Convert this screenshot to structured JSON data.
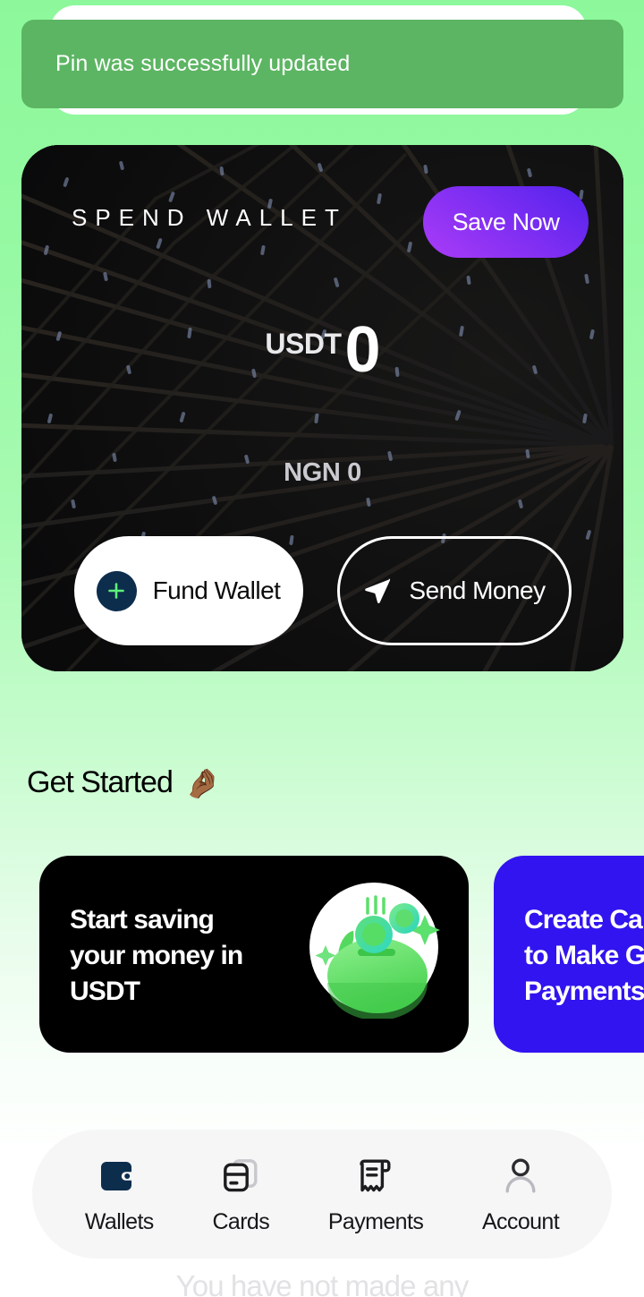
{
  "toast": {
    "message": "Pin was successfully updated",
    "bg_color": "#5CB562",
    "text_color": "#FFFFFF"
  },
  "wallet_card": {
    "label": "SPEND WALLET",
    "save_button": "Save Now",
    "save_button_gradient_from": "#5222EC",
    "save_button_gradient_to": "#AB3CF7",
    "usdt_currency": "USDT",
    "usdt_amount": "0",
    "ngn_balance": "NGN 0",
    "fund_button": "Fund Wallet",
    "send_button": "Send Money",
    "bg_color": "#0D0D0E"
  },
  "get_started": {
    "title": "Get Started",
    "emoji": "🤌🏾"
  },
  "promos": [
    {
      "title": "Start saving\nyour money in\nUSDT",
      "bg_color": "#000000",
      "illustration": "piggy-bank-usdt"
    },
    {
      "title": "Create Cards\nto Make Global\nPayments",
      "bg_color": "#3114EF",
      "illustration": "none"
    }
  ],
  "bottom_nav": {
    "items": [
      {
        "label": "Wallets",
        "icon": "wallet-icon",
        "active": true
      },
      {
        "label": "Cards",
        "icon": "cards-icon",
        "active": false
      },
      {
        "label": "Payments",
        "icon": "receipt-icon",
        "active": false
      },
      {
        "label": "Account",
        "icon": "person-icon",
        "active": false
      }
    ],
    "bg_color": "#F6F6F7",
    "active_color": "#0D2D4D"
  },
  "bottom_text": "You have not made any"
}
